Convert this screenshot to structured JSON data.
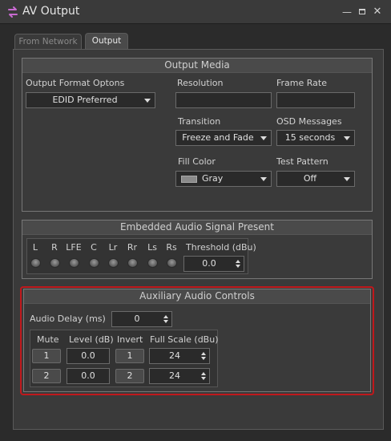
{
  "window": {
    "title": "AV Output",
    "icon": "av-swap-icon",
    "controls": [
      "minimize-icon",
      "maximize-icon",
      "close-icon"
    ]
  },
  "tabs": [
    {
      "label": "From Network",
      "active": false
    },
    {
      "label": "Output",
      "active": true
    }
  ],
  "output_media": {
    "title": "Output Media",
    "format_label": "Output Format Optons",
    "format_value": "EDID Preferred",
    "resolution_label": "Resolution",
    "resolution_value": "",
    "frame_rate_label": "Frame Rate",
    "frame_rate_value": "",
    "transition_label": "Transition",
    "transition_value": "Freeze and Fade",
    "osd_label": "OSD Messages",
    "osd_value": "15 seconds",
    "fill_color_label": "Fill Color",
    "fill_color_value": "Gray",
    "fill_color_swatch": "#8a8a8a",
    "test_pattern_label": "Test Pattern",
    "test_pattern_value": "Off"
  },
  "embedded_audio": {
    "title": "Embedded Audio Signal Present",
    "channels": [
      "L",
      "R",
      "LFE",
      "C",
      "Lr",
      "Rr",
      "Ls",
      "Rs"
    ],
    "threshold_label": "Threshold (dBu)",
    "threshold_value": "0.0"
  },
  "aux_audio": {
    "title": "Auxiliary Audio Controls",
    "delay_label": "Audio Delay (ms)",
    "delay_value": "0",
    "headers": {
      "mute": "Mute",
      "level": "Level (dB)",
      "invert": "Invert",
      "full_scale": "Full Scale (dBu)"
    },
    "rows": [
      {
        "mute": "1",
        "level": "0.0",
        "invert": "1",
        "full_scale": "24"
      },
      {
        "mute": "2",
        "level": "0.0",
        "invert": "2",
        "full_scale": "24"
      }
    ],
    "highlight_color": "#c0181c"
  }
}
